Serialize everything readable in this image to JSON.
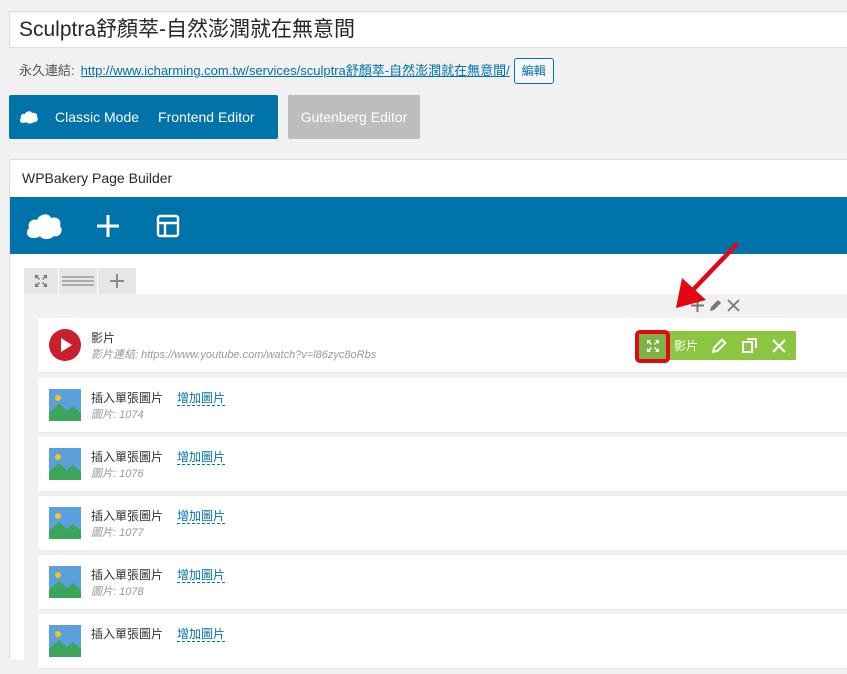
{
  "post": {
    "title": "Sculptra舒顏萃-自然澎潤就在無意間"
  },
  "permalink": {
    "label": "永久連結:",
    "url_prefix": "http://www.icharming.com.tw/services/",
    "url_slug": "sculptra舒顏萃-自然澎潤就在無意間",
    "url_suffix": "/",
    "edit_label": "編輯"
  },
  "modes": {
    "logo_icon": "wpbakery-cloud-icon",
    "classic_label": "Classic Mode",
    "frontend_label": "Frontend Editor",
    "gutenberg_label": "Gutenberg Editor"
  },
  "builder": {
    "title": "WPBakery Page Builder",
    "toolbar_icons": [
      "wpbakery-cloud-icon",
      "plus-icon",
      "template-layout-icon"
    ],
    "colors": {
      "accent": "#0073aa",
      "element_hover": "#8cc53f",
      "highlight": "#e30613"
    }
  },
  "elements": [
    {
      "type": "video",
      "title": "影片",
      "subtitle": "影片連結: https://www.youtube.com/watch?v=l86zyc8oRbs",
      "hover_label": "影片",
      "icon": "play-icon"
    },
    {
      "type": "single-image",
      "title": "插入單張圖片",
      "link": "增加圖片",
      "subtitle": "圖片: 1074",
      "icon": "image-icon"
    },
    {
      "type": "single-image",
      "title": "插入單張圖片",
      "link": "增加圖片",
      "subtitle": "圖片: 1076",
      "icon": "image-icon"
    },
    {
      "type": "single-image",
      "title": "插入單張圖片",
      "link": "增加圖片",
      "subtitle": "圖片: 1077",
      "icon": "image-icon"
    },
    {
      "type": "single-image",
      "title": "插入單張圖片",
      "link": "增加圖片",
      "subtitle": "圖片: 1078",
      "icon": "image-icon"
    },
    {
      "type": "single-image",
      "title": "插入單張圖片",
      "link": "增加圖片",
      "subtitle": "",
      "icon": "image-icon"
    }
  ]
}
